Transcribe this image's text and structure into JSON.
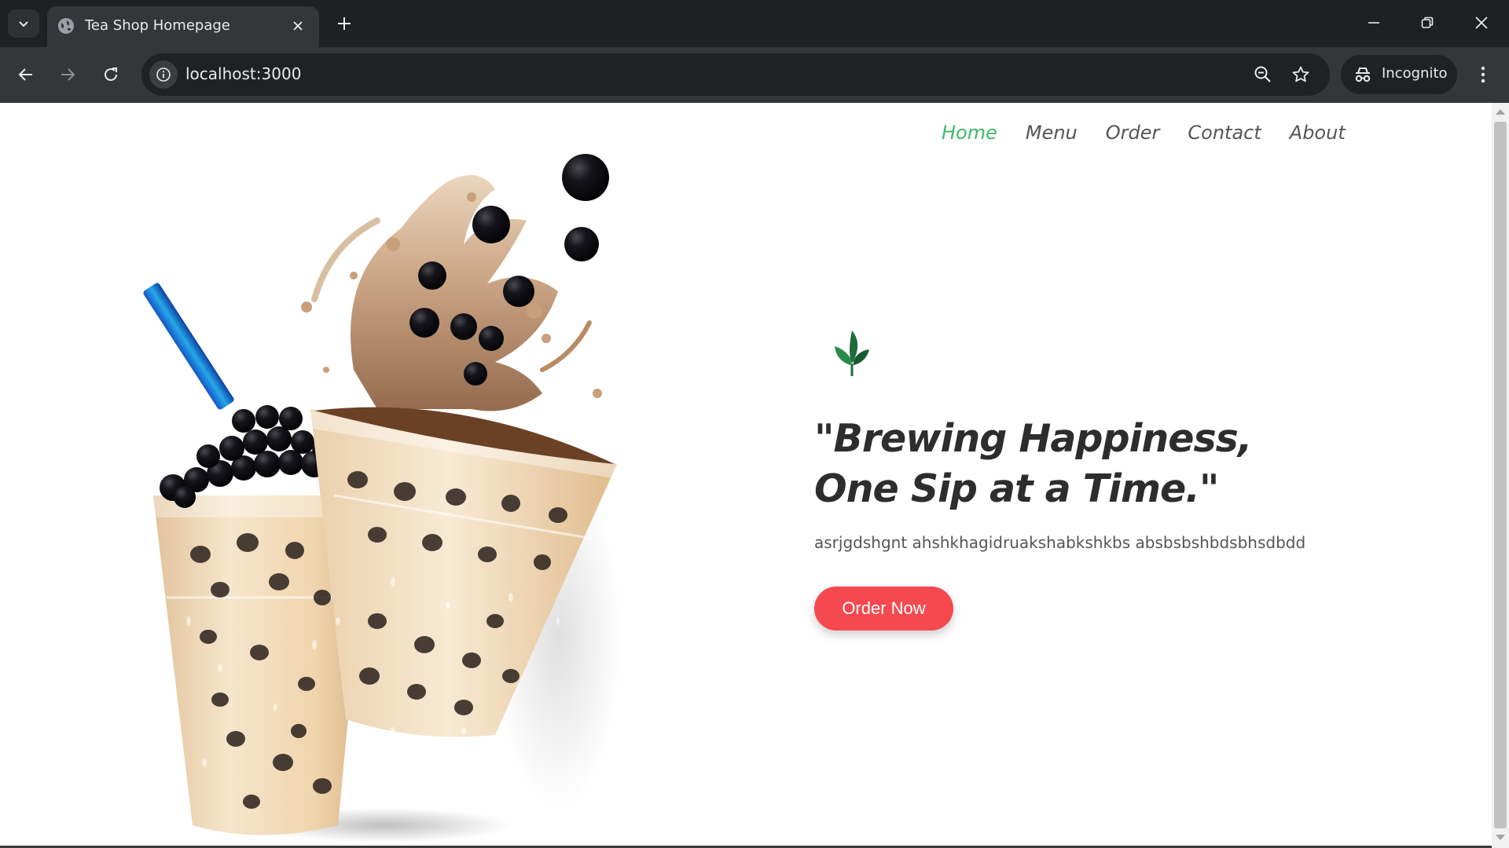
{
  "browser": {
    "tab_title": "Tea Shop Homepage",
    "url": "localhost:3000",
    "incognito_label": "Incognito",
    "icons": {
      "tab_search": "chevron-down-icon",
      "favicon": "globe-icon",
      "tab_close": "close-icon",
      "new_tab": "plus-icon",
      "minimize": "minimize-icon",
      "restore": "restore-icon",
      "close_window": "close-icon",
      "back": "arrow-left-icon",
      "forward": "arrow-right-icon",
      "reload": "reload-icon",
      "site_info": "info-icon",
      "zoom": "zoom-out-icon",
      "bookmark": "star-icon",
      "incognito": "incognito-icon",
      "menu": "kebab-icon"
    }
  },
  "site": {
    "nav": [
      {
        "label": "Home",
        "active": true
      },
      {
        "label": "Menu",
        "active": false
      },
      {
        "label": "Order",
        "active": false
      },
      {
        "label": "Contact",
        "active": false
      },
      {
        "label": "About",
        "active": false
      }
    ],
    "headline_line1": "\"Brewing Happiness,",
    "headline_line2": "One Sip at a Time.\"",
    "subtext": "asrjgdshgnt ahshkhagidruakshabkshkbs absbsbshbdsbhsdbdd",
    "cta_label": "Order Now",
    "colors": {
      "accent_green": "#3cbb68",
      "cta_red": "#f5484f",
      "headline": "#2d2d2d",
      "leaf": "#1f6b3a"
    }
  }
}
